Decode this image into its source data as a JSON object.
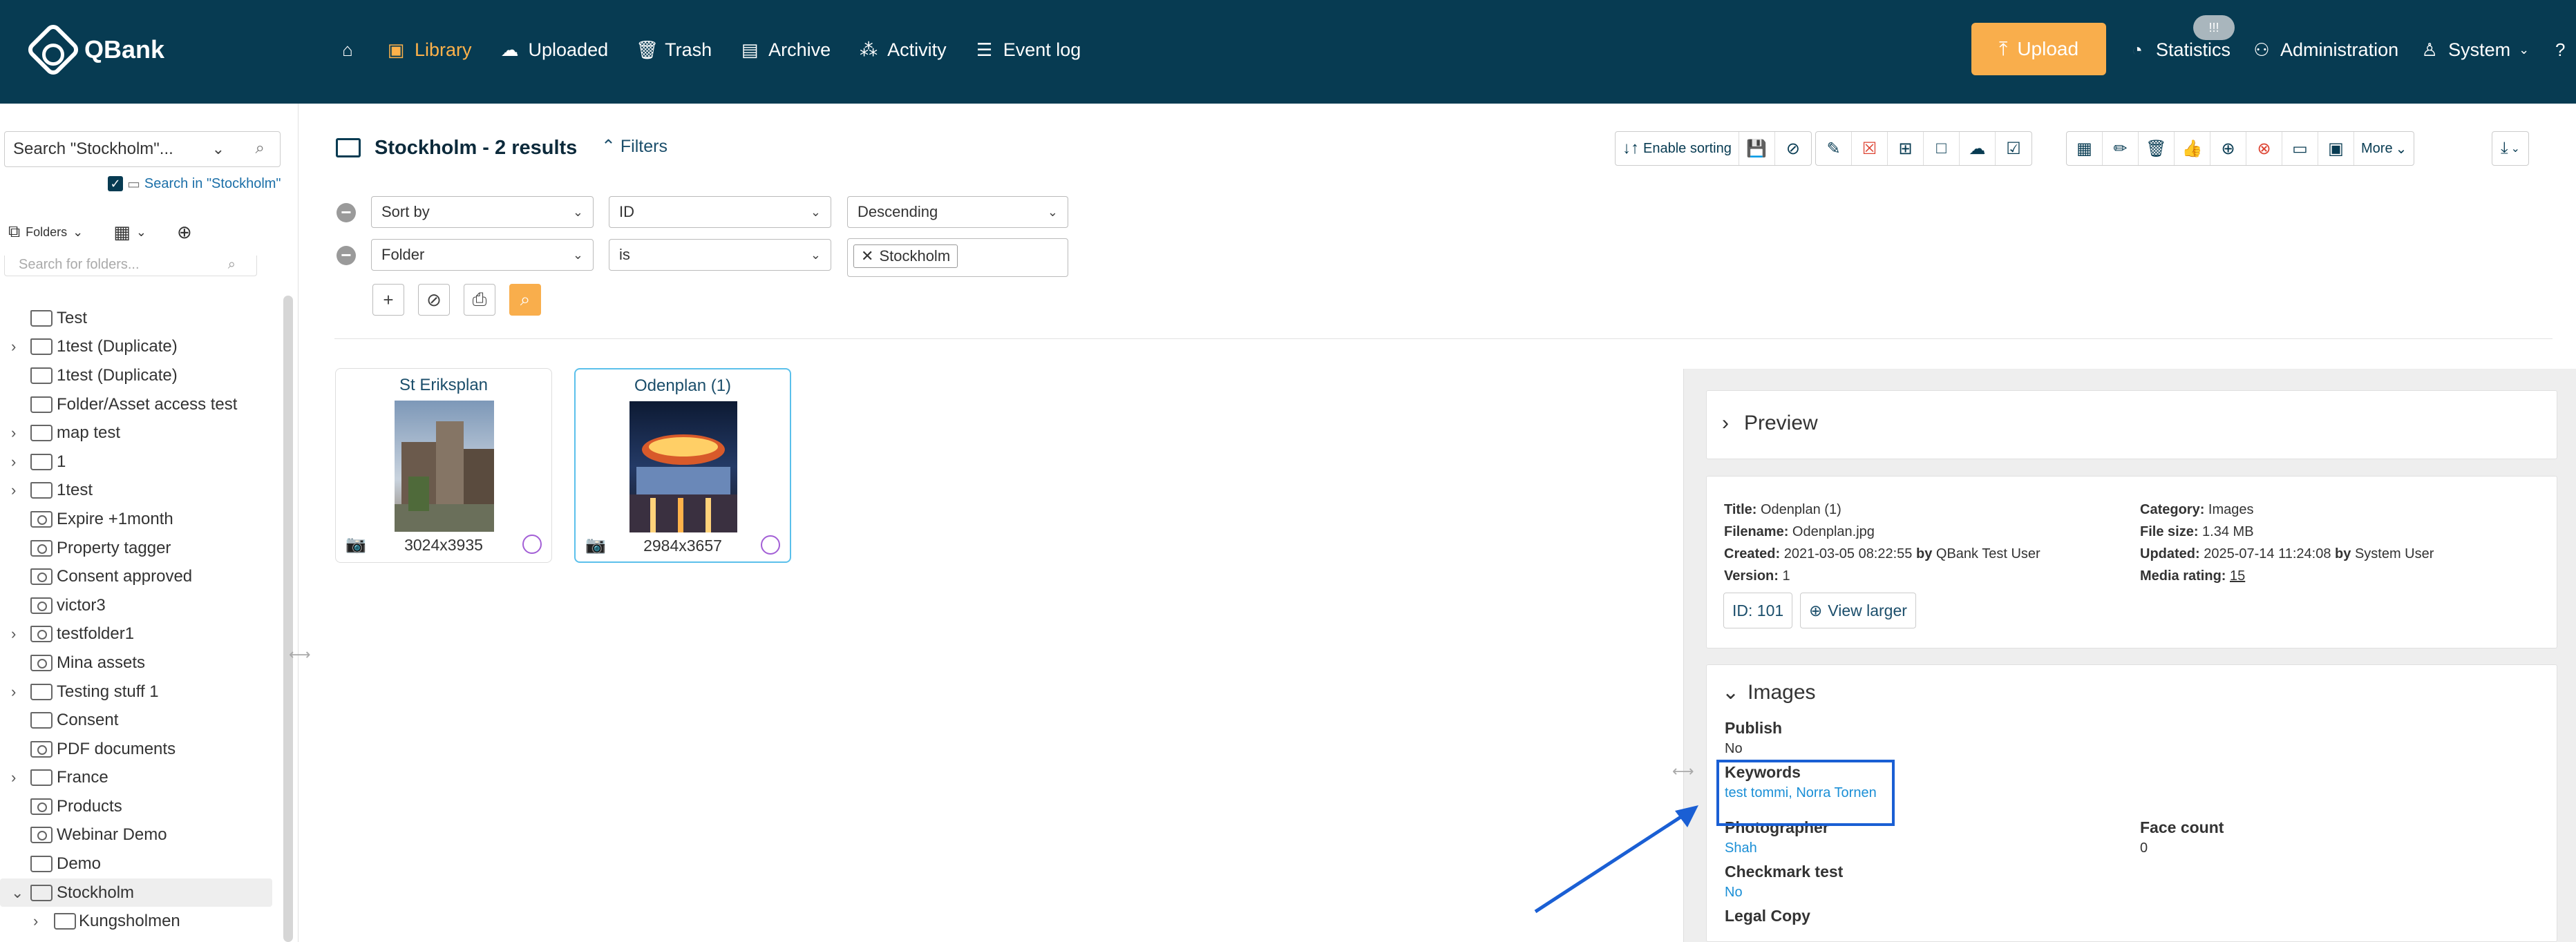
{
  "app": {
    "name": "QBank"
  },
  "nav": [
    {
      "label": "Library",
      "icon": "book"
    },
    {
      "label": "Uploaded",
      "icon": "cloud"
    },
    {
      "label": "Trash",
      "icon": "trash"
    },
    {
      "label": "Archive",
      "icon": "archive"
    },
    {
      "label": "Activity",
      "icon": "nodes"
    },
    {
      "label": "Event log",
      "icon": "list"
    }
  ],
  "upload_label": "Upload",
  "right_nav": [
    {
      "label": "Statistics"
    },
    {
      "label": "Administration"
    },
    {
      "label": "System"
    }
  ],
  "notif_badge": "!!!",
  "sidebar": {
    "search_value": "Search \"Stockholm\"...",
    "search_in_label": "Search in \"Stockholm\"",
    "folders_label": "Folders",
    "folder_search_placeholder": "Search for folders...",
    "tree": [
      {
        "label": "Test"
      },
      {
        "label": "1test (Duplicate)"
      },
      {
        "label": "1test (Duplicate)"
      },
      {
        "label": "Folder/Asset access test"
      },
      {
        "label": "map test"
      },
      {
        "label": "1"
      },
      {
        "label": "1test"
      },
      {
        "label": "Expire +1month"
      },
      {
        "label": "Property tagger"
      },
      {
        "label": "Consent approved"
      },
      {
        "label": "victor3"
      },
      {
        "label": "testfolder1"
      },
      {
        "label": "Mina assets"
      },
      {
        "label": "Testing stuff 1"
      },
      {
        "label": "Consent"
      },
      {
        "label": "PDF documents"
      },
      {
        "label": "France"
      },
      {
        "label": "Products"
      },
      {
        "label": "Webinar Demo"
      },
      {
        "label": "Demo"
      },
      {
        "label": "Stockholm"
      },
      {
        "label": "Kungsholmen"
      }
    ]
  },
  "main": {
    "title": "Stockholm - 2 results",
    "filters_label": "Filters",
    "toolbar": {
      "enable_sorting": "Enable sorting",
      "more": "More"
    },
    "filter_rows": [
      {
        "field": "Sort by",
        "op": "ID",
        "value": "Descending"
      },
      {
        "field": "Folder",
        "op": "is",
        "tag": "Stockholm"
      }
    ],
    "cards": [
      {
        "title": "St Eriksplan",
        "dims": "3024x3935"
      },
      {
        "title": "Odenplan (1)",
        "dims": "2984x3657"
      }
    ]
  },
  "panel": {
    "preview_title": "Preview",
    "meta_left": [
      {
        "k": "Title:",
        "v": "Odenplan (1)"
      },
      {
        "k": "Filename:",
        "v": "Odenplan.jpg"
      },
      {
        "k": "Created:",
        "v": "2021-03-05 08:22:55",
        "by": "by",
        "who": "QBank Test User"
      },
      {
        "k": "Version:",
        "v": "1"
      }
    ],
    "meta_right": [
      {
        "k": "Category:",
        "v": "Images"
      },
      {
        "k": "File size:",
        "v": "1.34 MB"
      },
      {
        "k": "Updated:",
        "v": "2025-07-14 11:24:08",
        "by": "by",
        "who": "System User"
      },
      {
        "k": "Media rating:",
        "v": "15"
      }
    ],
    "id_label": "ID: 101",
    "view_larger": "View larger",
    "images_title": "Images",
    "fields": {
      "publish_label": "Publish",
      "publish_value": "No",
      "keywords_label": "Keywords",
      "keywords_value": "test tommi, Norra Tornen",
      "photographer_label": "Photographer",
      "photographer_value": "Shah",
      "face_count_label": "Face count",
      "face_count_value": "0",
      "checkmark_label": "Checkmark test",
      "checkmark_value": "No",
      "legal_label": "Legal Copy"
    }
  }
}
